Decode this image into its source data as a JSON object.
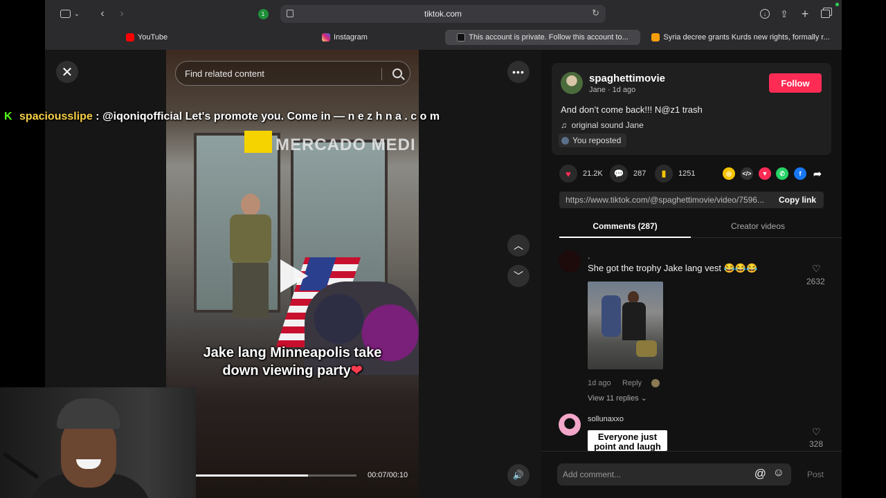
{
  "browser": {
    "url": "tiktok.com",
    "tabs": [
      {
        "label": "YouTube",
        "color": "#ff0000",
        "active": false
      },
      {
        "label": "Instagram",
        "color": "#d62976",
        "active": false
      },
      {
        "label": "This account is private. Follow this account to...",
        "color": "#111111",
        "active": true
      },
      {
        "label": "Syria decree grants Kurds new rights, formally r...",
        "color": "#f59e0b",
        "active": false
      }
    ],
    "extension_badge": "1"
  },
  "video": {
    "search_placeholder": "Find related content",
    "sign_text": "MERCADO MEDI",
    "caption_line1": "Jake lang Minneapolis take",
    "caption_line2": "down viewing party",
    "caption_heart": "❤",
    "time": "00:07/00:10",
    "progress": 0.7
  },
  "post": {
    "username": "spaghettimovie",
    "meta": "Jane · 1d ago",
    "follow_label": "Follow",
    "description": "And don’t come back!!! N@z1 trash",
    "sound": "original sound Jane",
    "reposted": "You reposted",
    "likes": "21.2K",
    "comments": "287",
    "saves": "1251",
    "link": "https://www.tiktok.com/@spaghettimovie/video/7596...",
    "copy_link": "Copy link"
  },
  "tabs": {
    "comments": "Comments (287)",
    "creator_videos": "Creator videos"
  },
  "comments": [
    {
      "user": ".",
      "text": "She got the trophy Jake lang vest 😂😂😂",
      "likes": "2632",
      "time": "1d ago",
      "reply": "Reply",
      "view_replies": "View 11 replies"
    },
    {
      "user": "sollunaxxo",
      "text": "Everyone just point and laugh",
      "likes": "328"
    }
  ],
  "comment_box": {
    "placeholder": "Add comment...",
    "post": "Post"
  },
  "overlay": {
    "chat_user": "spaciousslipe",
    "chat_sep": " : ",
    "chat_message": "@iqoniqofficial Let's promote you. Come in — n e z h n a . c o m"
  },
  "colors": {
    "accent": "#fe2c55",
    "chat_user": "#f7d046",
    "chat_badge": "#53fc18"
  }
}
